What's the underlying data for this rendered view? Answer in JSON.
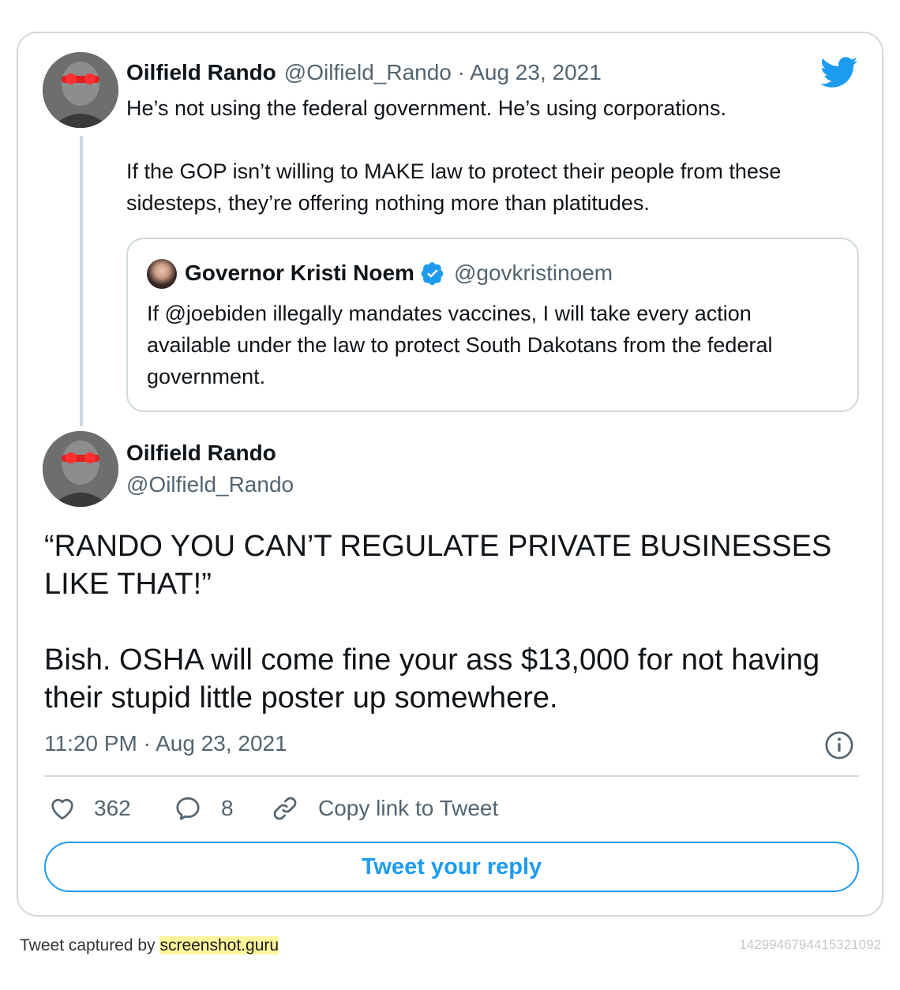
{
  "parent_tweet": {
    "display_name": "Oilfield Rando",
    "handle_date": "@Oilfield_Rando · Aug 23, 2021",
    "text_line1": "He’s not using the federal government. He’s using corporations.",
    "text_line2": "If the GOP isn’t willing to MAKE law to protect their people from these sidesteps, they’re offering nothing more than platitudes."
  },
  "quoted_tweet": {
    "display_name": "Governor Kristi Noem",
    "handle": "@govkristinoem",
    "text": "If @joebiden illegally mandates vaccines, I will take every action available under the law to protect South Dakotans from the federal government."
  },
  "main_tweet": {
    "display_name": "Oilfield Rando",
    "handle": "@Oilfield_Rando",
    "text_para1": "“RANDO YOU CAN’T REGULATE PRIVATE BUSINESSES LIKE THAT!”",
    "text_para2": "Bish. OSHA will come fine your ass $13,000 for not having their stupid little poster up somewhere.",
    "timestamp": "11:20 PM · Aug 23, 2021"
  },
  "actions": {
    "likes": "362",
    "replies": "8",
    "copy_link": "Copy link to Tweet"
  },
  "reply_button": "Tweet your reply",
  "footer": {
    "captured_prefix": "Tweet captured by",
    "captured_link": "screenshot.guru",
    "tweet_id": "1429946794415321092"
  },
  "colors": {
    "accent_blue": "#1d9bf0",
    "muted_gray": "#536471",
    "border": "#cfd9de"
  },
  "icons": [
    "twitter-bird-icon",
    "verified-badge-icon",
    "info-icon",
    "heart-icon",
    "reply-icon",
    "link-icon"
  ]
}
